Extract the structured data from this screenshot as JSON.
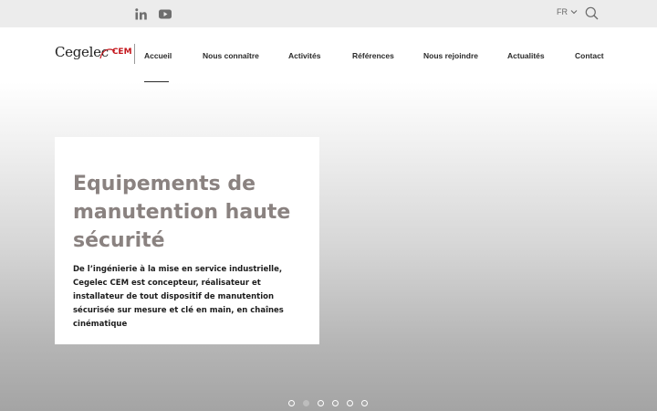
{
  "topbar": {
    "lang_label": "FR",
    "social_icons": [
      "linkedin-icon",
      "youtube-icon"
    ]
  },
  "logo": {
    "brand": "Cegelec",
    "sub": "CEM"
  },
  "nav": {
    "items": [
      {
        "label": "Accueil",
        "active": true
      },
      {
        "label": "Nous connaître"
      },
      {
        "label": "Activités"
      },
      {
        "label": "Références"
      },
      {
        "label": "Nous rejoindre"
      },
      {
        "label": "Actualités"
      },
      {
        "label": "Contact"
      }
    ]
  },
  "hero": {
    "title": "Equipements de manutention haute sécurité",
    "description": "De l’ingénierie à la mise en service industrielle, Cegelec CEM est concepteur, réalisateur et installateur de tout dispositif de manutention sécurisée sur mesure et clé en main, en chaînes cinématique"
  },
  "slider": {
    "count": 6,
    "active_index": 1
  },
  "colors": {
    "brand_red": "#c4161c",
    "title_gray": "#8a8280",
    "topbar_bg": "#ececec"
  }
}
